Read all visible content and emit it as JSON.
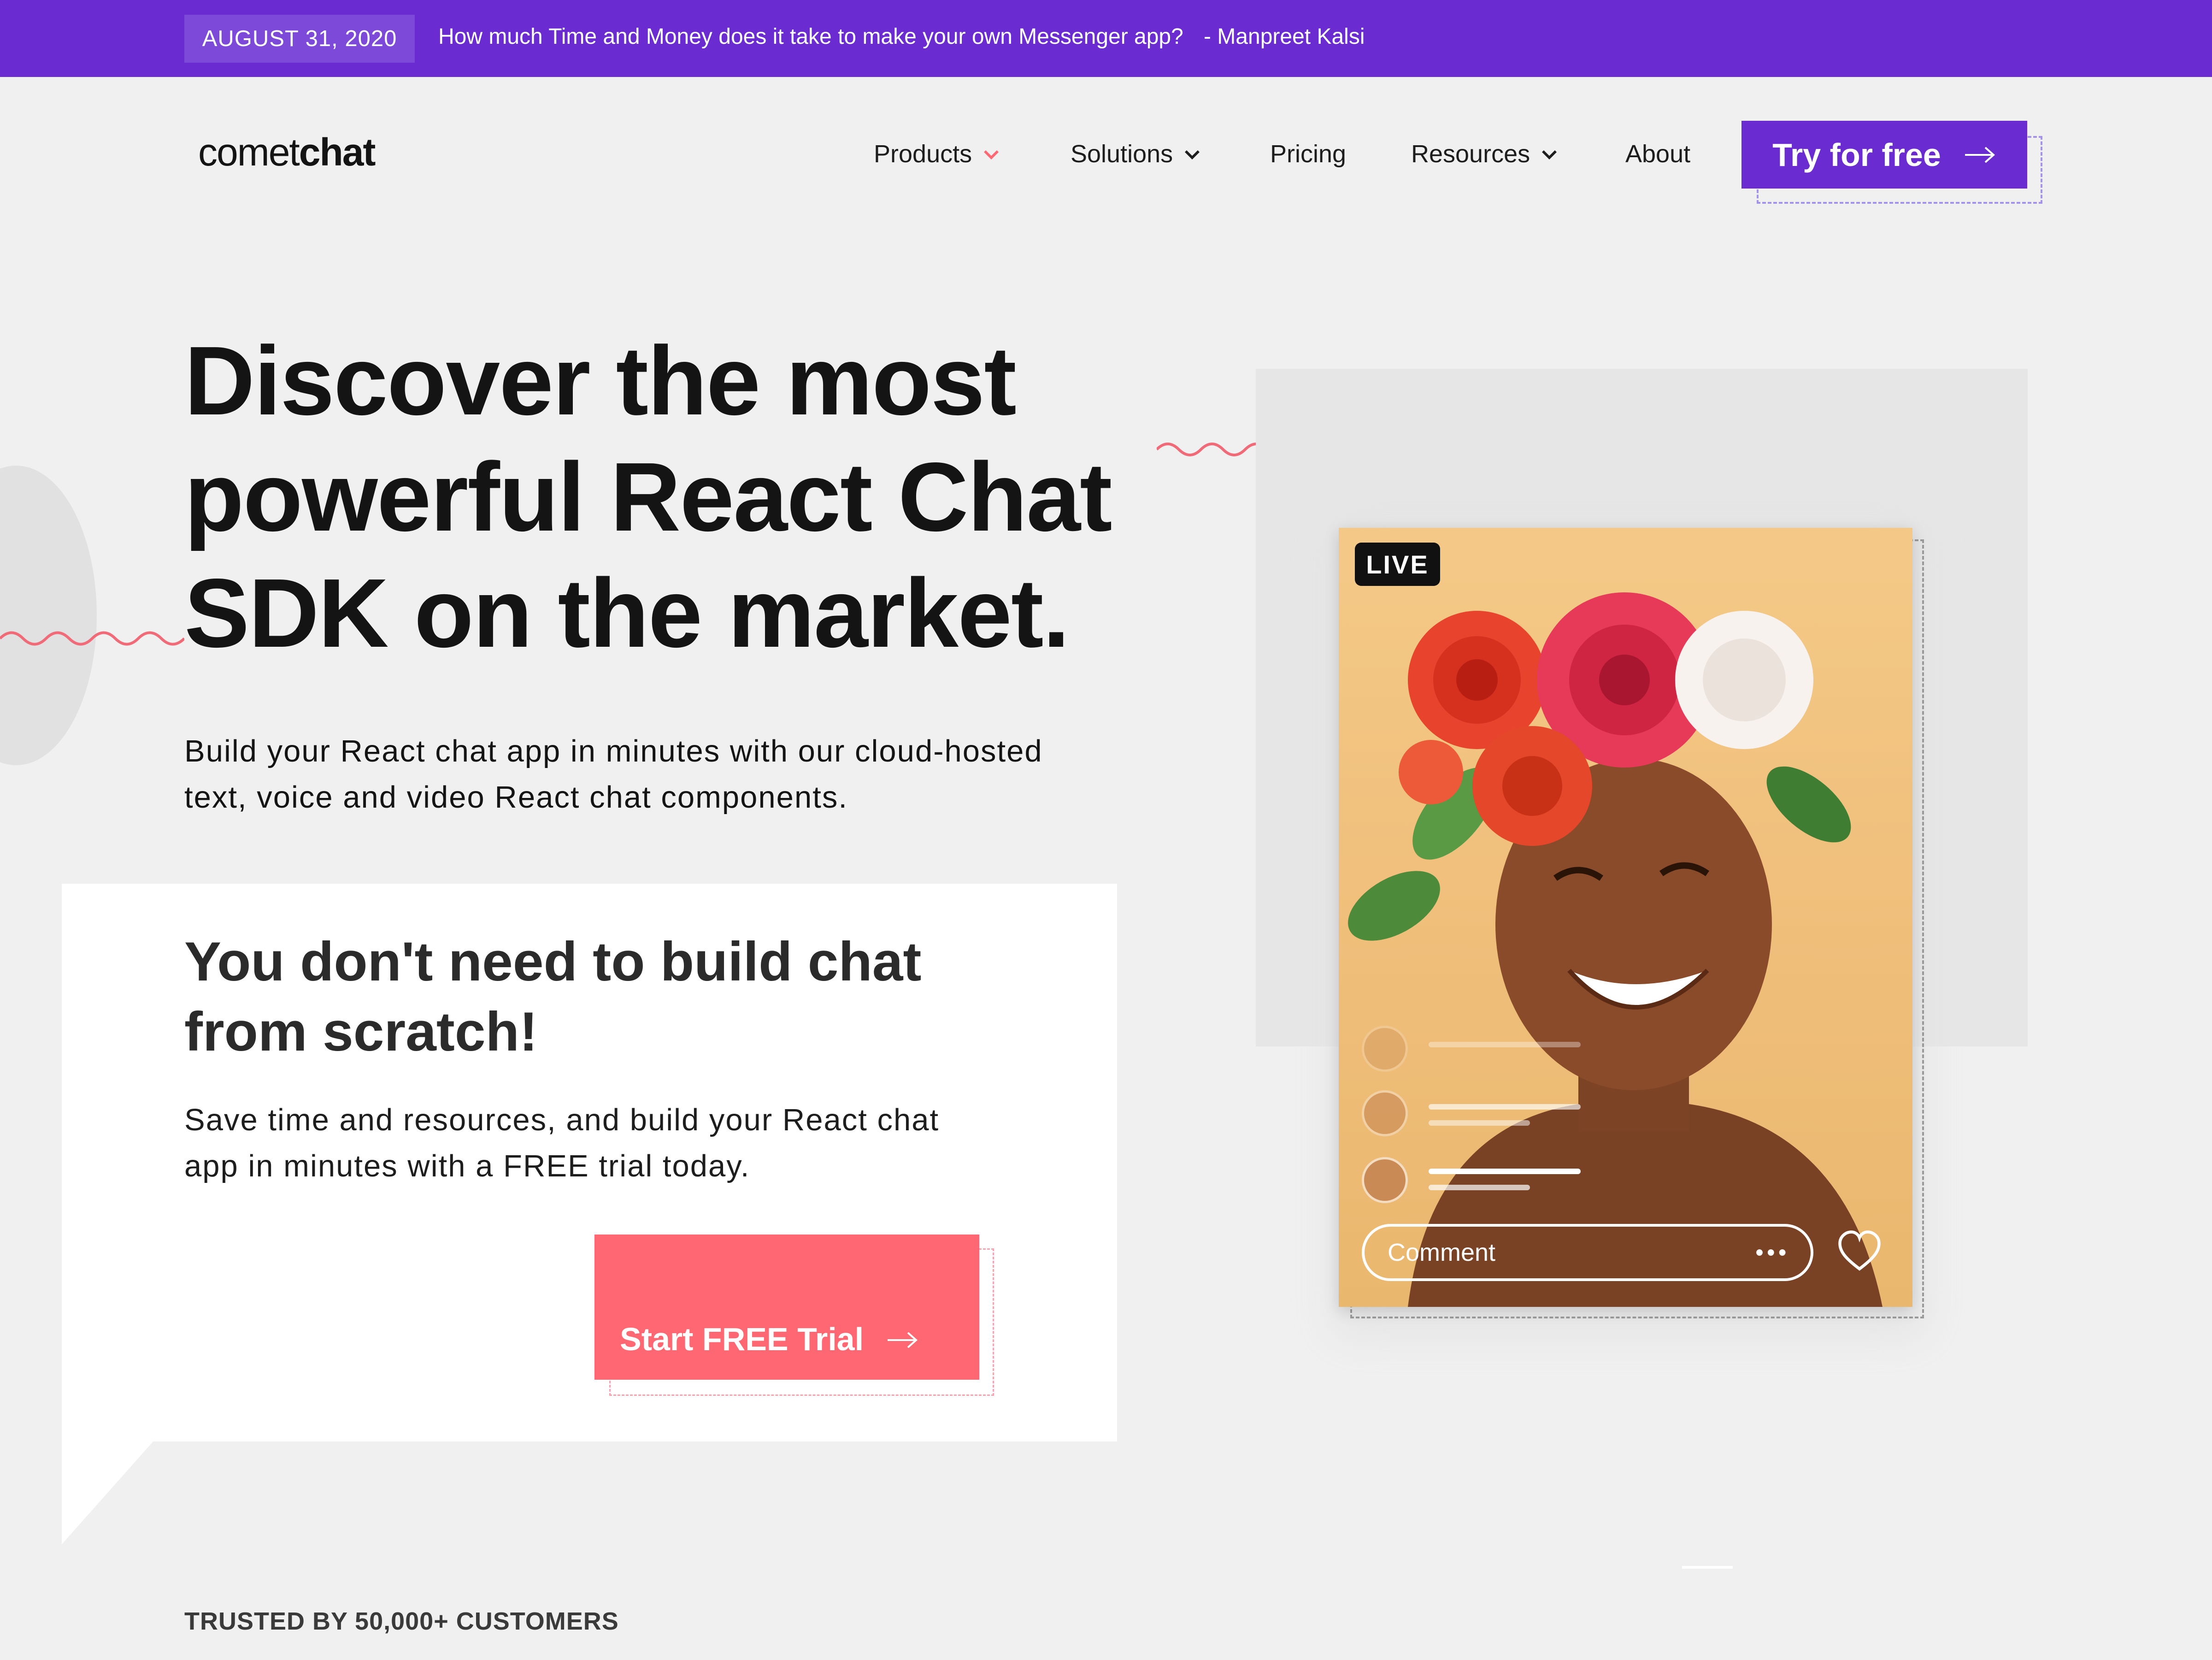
{
  "announcement": {
    "date": "AUGUST 31, 2020",
    "headline": "How much Time and Money does it take to make your own Messenger app?",
    "author": "- Manpreet Kalsi"
  },
  "nav": {
    "logo_part1": "comet",
    "logo_part2": "chat",
    "items": [
      {
        "label": "Products"
      },
      {
        "label": "Solutions"
      },
      {
        "label": "Pricing"
      },
      {
        "label": "Resources"
      },
      {
        "label": "About"
      }
    ],
    "cta_label": "Try for free",
    "accent_color": "#6a2bd0",
    "products_caret_color": "#ff6772"
  },
  "hero": {
    "title_line1": "Discover the most",
    "title_line2": "powerful React Chat",
    "title_line3": "SDK on the market.",
    "subtitle_line1": "Build your React chat app in minutes with our cloud-hosted",
    "subtitle_line2": "text, voice and video React chat components."
  },
  "card": {
    "title_line1": "You don't need to build chat",
    "title_line2": "from scratch!",
    "text_line1": "Save time and resources, and build your React chat",
    "text_line2": "app in minutes with a FREE trial today.",
    "cta_label": "Start FREE Trial",
    "cta_color": "#ff6772"
  },
  "trusted": {
    "label": "TRUSTED BY 50,000+ CUSTOMERS"
  },
  "phone": {
    "live_label": "LIVE",
    "comment_placeholder": "Comment",
    "more_icon": "ellipsis-icon",
    "heart_icon": "heart-icon"
  }
}
